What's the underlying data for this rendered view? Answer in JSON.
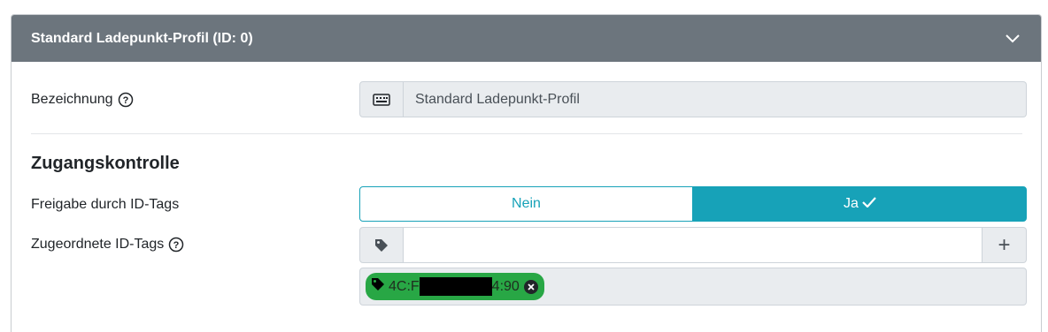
{
  "header": {
    "title": "Standard Ladepunkt-Profil (ID: 0)"
  },
  "bezeichnung": {
    "label": "Bezeichnung",
    "value": "Standard Ladepunkt-Profil"
  },
  "section": {
    "title": "Zugangskontrolle"
  },
  "freigabe": {
    "label": "Freigabe durch ID-Tags",
    "option_no": "Nein",
    "option_yes": "Ja",
    "selected": "Ja"
  },
  "id_tags": {
    "label": "Zugeordnete ID-Tags",
    "input_value": "",
    "add_label": "+",
    "tags": [
      {
        "prefix": "4C:F",
        "suffix": "4:90"
      }
    ]
  },
  "colors": {
    "header_bg": "#6c757d",
    "accent": "#17a2b8",
    "tag_bg": "#28a745"
  }
}
